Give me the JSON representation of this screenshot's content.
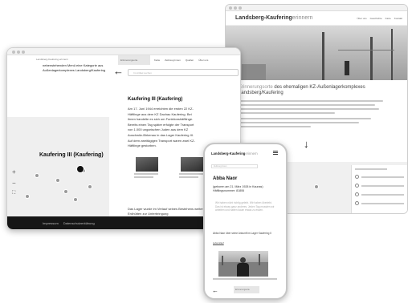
{
  "back_site": {
    "logo_main": "Landsberg-Kaufering",
    "logo_sub": "erinnern",
    "nav": [
      "Über uns",
      "Geschichte",
      "Karte",
      "Kontakt"
    ],
    "intro_title_light": "Erinnerungsorte",
    "intro_title_rest": "des ehemaligen KZ-Außenlagerkomplexes Landsberg/Kaufering"
  },
  "laptop": {
    "logo": "Landsberg-Kaufering erinnern",
    "search_tab": "Erinnerungsorte",
    "nav": [
      "Karte",
      "Zeitzeug:innen",
      "Quellen",
      "Über uns"
    ],
    "main_link": "nebenstehenden Menü eine Kategorie aus Außenlagerkomplexes Landsberg/Kaufering",
    "search_placeholder": "Im Artikel suchen",
    "article_title": "Kaufering III (Kaufering)",
    "article_text": "Am 17. Juni 1944 erreichten die ersten 22 KZ-Häftlinge aus dem KZ Dachau Kaufering. Bei ihnen handelte es sich um Funktionshäftlinge. Bereits einen Tag später erfolgte der Transport von 1.000 ungarischen Juden aus dem KZ Auschwitz-Birkenau in das Lager Kaufering III. Auf dem zweitägigen Transport waren zwei KZ-Häftlinge gestorben.",
    "bottom_text": "Das Lager wurde im Verlauf seines Bestehens weiter ausgebaut. Neben den Erdhütten zur Unterbringung",
    "map_label": "Kaufering III (Kaufering)",
    "footer_links": [
      "Impressum",
      "Datenschutzerklärung"
    ]
  },
  "phone": {
    "logo_main": "Landsberg-Kaufering",
    "logo_sub": "erinnern",
    "search_placeholder": "Zeitzeug:innen",
    "title": "Abba Naor",
    "subtitle": "(geboren am 21. März 1928 in Kaunas) Häftlingsnummer: 81806",
    "quote": "Wir haben nicht richtig gelebt. Wir haben überlebt. Das ist etwas ganz anderes. Jeden Tag mussten wir arbeiten und hatten kaum etwas zu essen.",
    "note": "Abba Naor über seine Ankunft im Lager Kaufering II",
    "more_link": "Lebenslauf",
    "tab": "Erinnerungsorte"
  }
}
